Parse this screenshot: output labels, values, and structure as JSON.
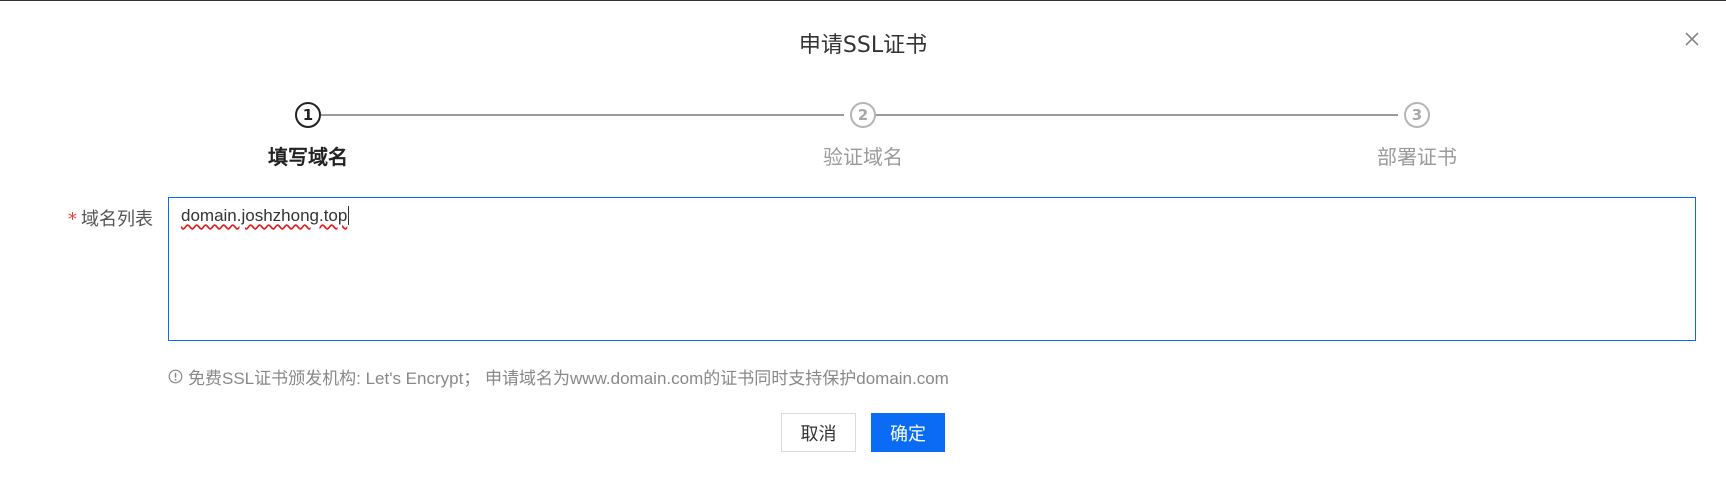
{
  "dialog": {
    "title": "申请SSL证书",
    "close_icon": "close-icon"
  },
  "steps": [
    {
      "number": "1",
      "label": "填写域名",
      "state": "active"
    },
    {
      "number": "2",
      "label": "验证域名",
      "state": "inactive"
    },
    {
      "number": "3",
      "label": "部署证书",
      "state": "inactive"
    }
  ],
  "form": {
    "required_mark": "*",
    "domain_list_label": "域名列表",
    "domain_list_value": "domain.joshzhong.top",
    "hint_icon": "info-circle-icon",
    "hint_text": "免费SSL证书颁发机构: Let's Encrypt；  申请域名为www.domain.com的证书同时支持保护domain.com"
  },
  "buttons": {
    "cancel_label": "取消",
    "ok_label": "确定"
  },
  "colors": {
    "primary": "#0a6cf5",
    "required": "#e54545",
    "muted": "#9a9a9a"
  }
}
